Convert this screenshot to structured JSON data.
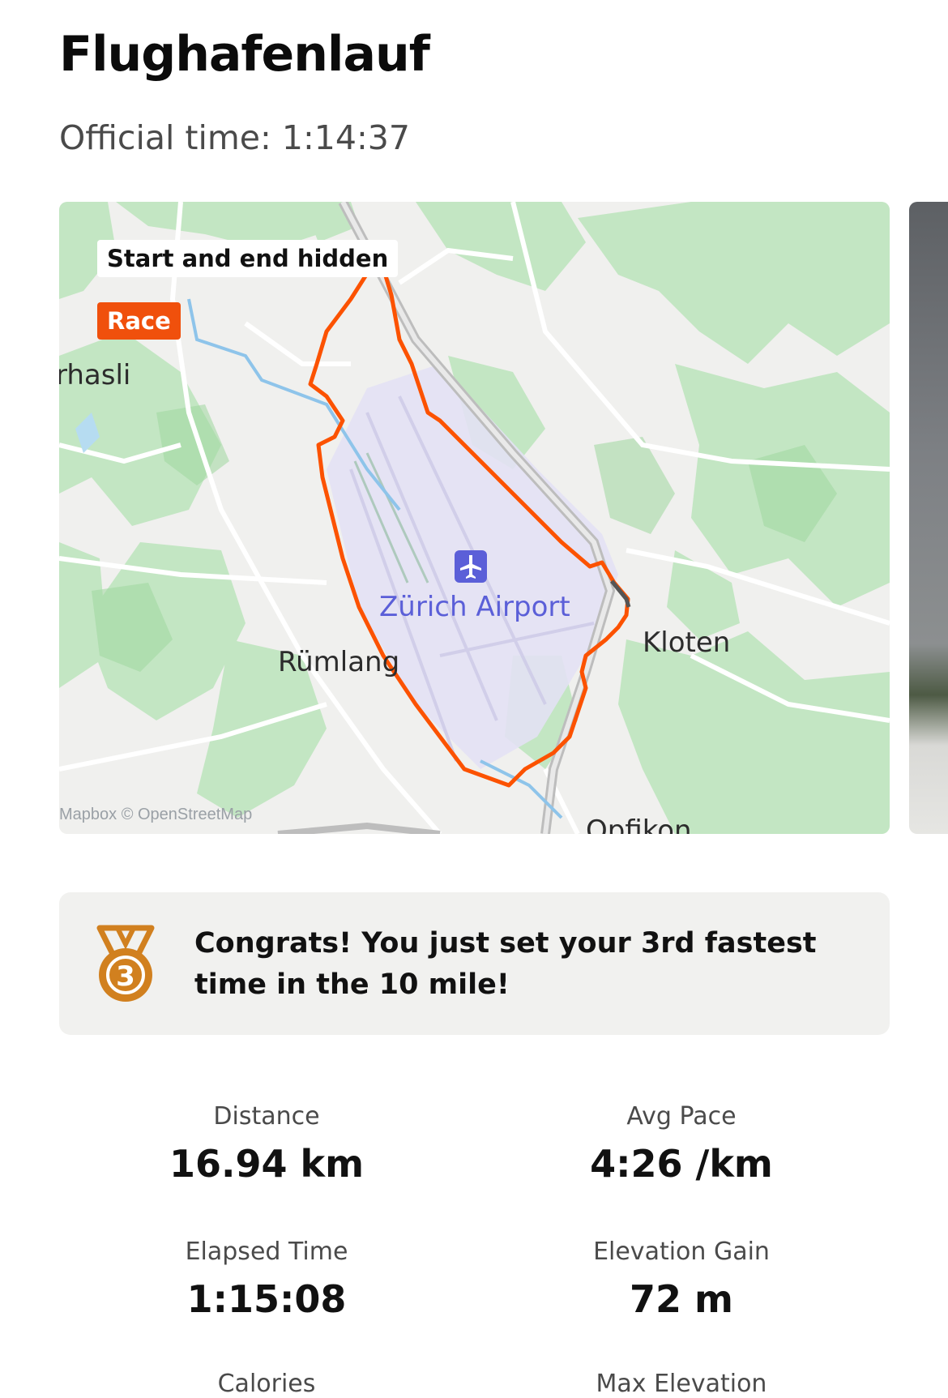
{
  "activity": {
    "title": "Flughafenlauf",
    "official_time": "Official time: 1:14:37"
  },
  "map": {
    "privacy_badge": "Start and end hidden",
    "race_badge": "Race",
    "places": {
      "left_edge": "rhasli",
      "airport": "Zürich Airport",
      "rumlang": "Rümlang",
      "kloten": "Kloten",
      "opfikon": "Opfikon"
    },
    "attribution": "Mapbox © OpenStreetMap",
    "route_color": "#fc5200",
    "icons": [
      "airplane-icon"
    ]
  },
  "achievement": {
    "icon": "bronze-medal-icon",
    "medal_number": "3",
    "text": "Congrats! You just set your 3rd fastest time in the 10 mile!",
    "medal_color": "#d1801f"
  },
  "stats": [
    {
      "label": "Distance",
      "value": "16.94 km"
    },
    {
      "label": "Avg Pace",
      "value": "4:26 /km"
    },
    {
      "label": "Elapsed Time",
      "value": "1:15:08"
    },
    {
      "label": "Elevation Gain",
      "value": "72 m"
    },
    {
      "label": "Calories",
      "value": ""
    },
    {
      "label": "Max Elevation",
      "value": ""
    }
  ]
}
